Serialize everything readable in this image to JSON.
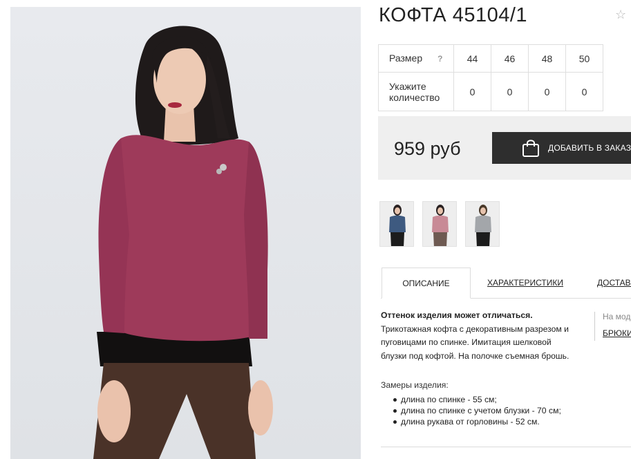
{
  "product": {
    "title": "КОФТА 45104/1",
    "favorite_icon": "star-outline-icon"
  },
  "sizes": {
    "size_label": "Размер",
    "help_label": "?",
    "quantity_label_line1": "Укажите",
    "quantity_label_line2": "количество",
    "values": [
      "44",
      "46",
      "48",
      "50"
    ],
    "quantities": [
      "0",
      "0",
      "0",
      "0"
    ]
  },
  "price": {
    "value": "959 руб",
    "order_button": "ДОБАВИТЬ В ЗАКАЗ",
    "order_icon": "shopping-bag-icon"
  },
  "thumbnails": [
    {
      "color": "#3e5a80",
      "label": "navy"
    },
    {
      "color": "#c88a96",
      "label": "pink"
    },
    {
      "color": "#a3a6aa",
      "label": "grey"
    }
  ],
  "tabs": [
    "ОПИСАНИЕ",
    "ХАРАКТЕРИСТИКИ",
    "ДОСТАВКА"
  ],
  "description": {
    "note": "Оттенок изделия может отличаться.",
    "line1": "Трикотажная кофта с декоративным разрезом и",
    "line2": "пуговицами по спинке. Имитация шелковой",
    "line3": "блузки под кофтой. На полочке съемная брошь."
  },
  "side": {
    "note": "На модели",
    "link": "БРЮКИ"
  },
  "measurements": {
    "title": "Замеры изделия:",
    "items": [
      "длина по спинке - 55 см;",
      "длина по спинке с учетом блузки - 70 см;",
      "длина рукава от горловины - 52 см."
    ]
  },
  "colors": {
    "sweater": "#9e3a5a",
    "pants": "#4a3228",
    "button_bg": "#2e2e2e",
    "price_bg": "#efefef"
  }
}
